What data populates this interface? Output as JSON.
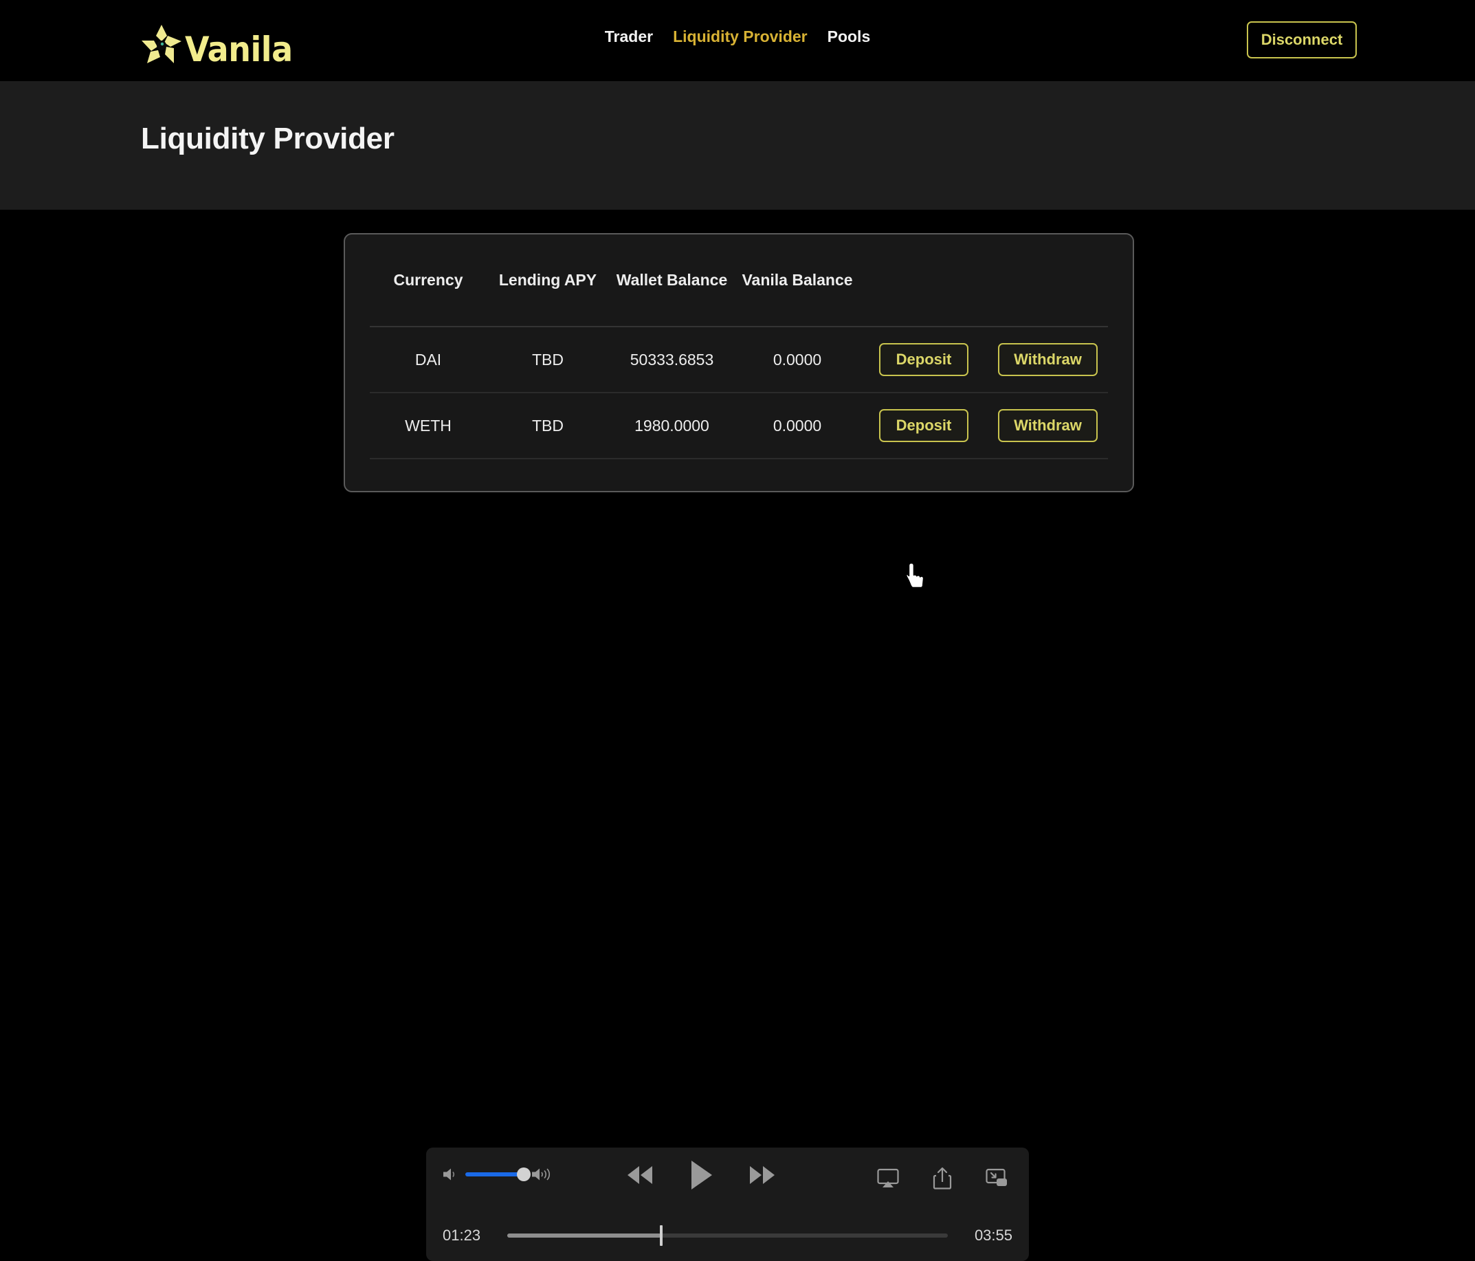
{
  "navbar": {
    "brand_name": "Vanila",
    "brand_logo_icon": "flower-icon",
    "links": [
      {
        "label": "Trader",
        "active": false
      },
      {
        "label": "Liquidity Provider",
        "active": true
      },
      {
        "label": "Pools",
        "active": false
      }
    ],
    "disconnect_label": "Disconnect"
  },
  "hero": {
    "title": "Liquidity Provider"
  },
  "table": {
    "headers": [
      "Currency",
      "Lending APY",
      "Wallet Balance",
      "Vanila Balance"
    ],
    "rows": [
      {
        "currency": "DAI",
        "lending_apy": "TBD",
        "wallet_balance": "50333.6853",
        "vanila_balance": "0.0000",
        "deposit_label": "Deposit",
        "withdraw_label": "Withdraw"
      },
      {
        "currency": "WETH",
        "lending_apy": "TBD",
        "wallet_balance": "1980.0000",
        "vanila_balance": "0.0000",
        "deposit_label": "Deposit",
        "withdraw_label": "Withdraw"
      }
    ]
  },
  "player": {
    "current_time": "01:23",
    "total_time": "03:55",
    "volume_percent": 100,
    "progress_percent": 35,
    "icons": {
      "volume_low": "speaker-low-icon",
      "volume_high": "speaker-high-icon",
      "rewind": "rewind-icon",
      "play": "play-icon",
      "fast_forward": "fast-forward-icon",
      "airplay": "airplay-icon",
      "share": "share-icon",
      "pip": "picture-in-picture-icon"
    }
  },
  "colors": {
    "accent_yellow": "#dcd768",
    "nav_active": "#d8b234",
    "brand_yellow": "#f2ec8c",
    "page_background": "#000000",
    "hero_background": "#1d1d1d",
    "card_background": "#181818",
    "volume_blue": "#1a6ae8"
  },
  "cursor": {
    "type": "pointing-hand"
  }
}
